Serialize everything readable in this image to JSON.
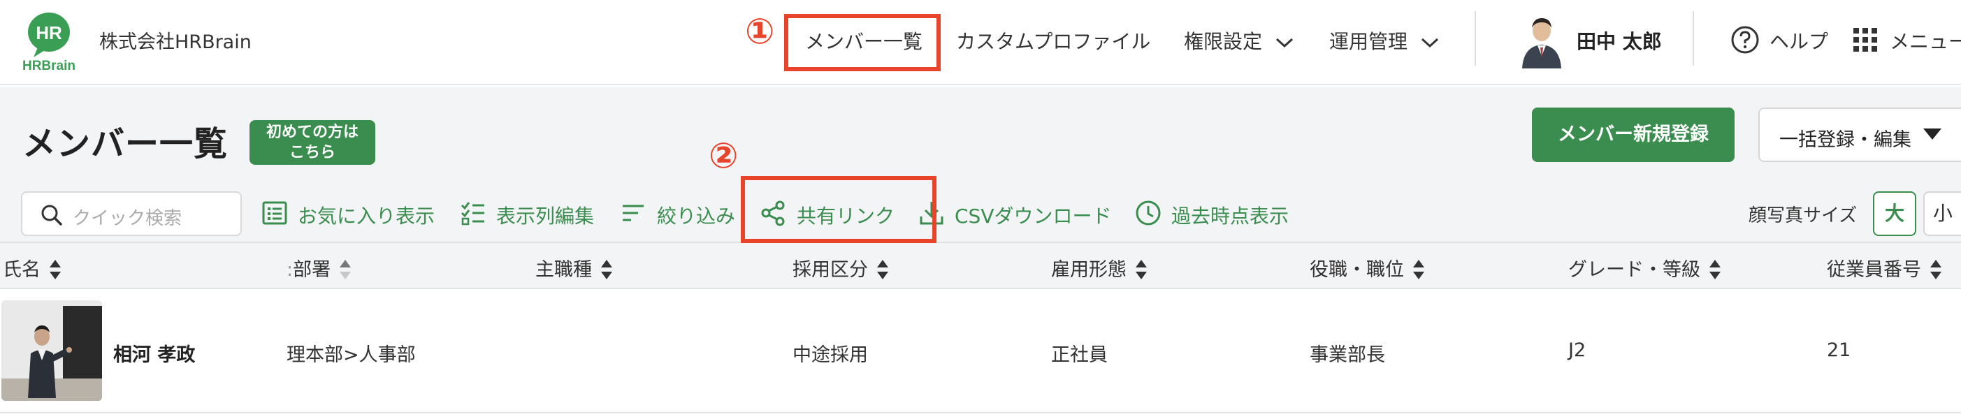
{
  "header": {
    "logo_text_top": "HR",
    "logo_text_bottom": "HRBrain",
    "company_name": "株式会社HRBrain",
    "nav": [
      {
        "label": "メンバー一覧"
      },
      {
        "label": "カスタムプロファイル"
      },
      {
        "label": "権限設定"
      },
      {
        "label": "運用管理"
      }
    ],
    "user_name": "田中 太郎",
    "help_label": "ヘルプ",
    "menu_label": "メニュー"
  },
  "annotations": {
    "step1": "①",
    "step2": "②"
  },
  "page": {
    "title": "メンバー一覧",
    "first_time_line1": "初めての方は",
    "first_time_line2": "こちら",
    "new_member_button": "メンバー新規登録",
    "bulk_button": "一括登録・編集"
  },
  "toolbar": {
    "search_placeholder": "クイック検索",
    "favorites": "お気に入り表示",
    "edit_columns": "表示列編集",
    "filter": "絞り込み",
    "share_link": "共有リンク",
    "csv_download": "CSVダウンロード",
    "past_view": "過去時点表示",
    "photo_size_label": "顔写真サイズ",
    "size_large": "大",
    "size_small": "小"
  },
  "table": {
    "columns": [
      "氏名",
      "部署",
      "主職種",
      "採用区分",
      "雇用形態",
      "役職・職位",
      "グレード・等級",
      "従業員番号"
    ],
    "rows": [
      {
        "name": "相河 孝政",
        "department": "理本部>人事部",
        "main_job": "",
        "hiring_type": "中途採用",
        "employment_type": "正社員",
        "position": "事業部長",
        "grade": "J2",
        "employee_number": "21"
      }
    ]
  },
  "colors": {
    "brand_green": "#3a8d4e",
    "callout_red": "#e8432b",
    "page_bg": "#f3f4f6"
  }
}
